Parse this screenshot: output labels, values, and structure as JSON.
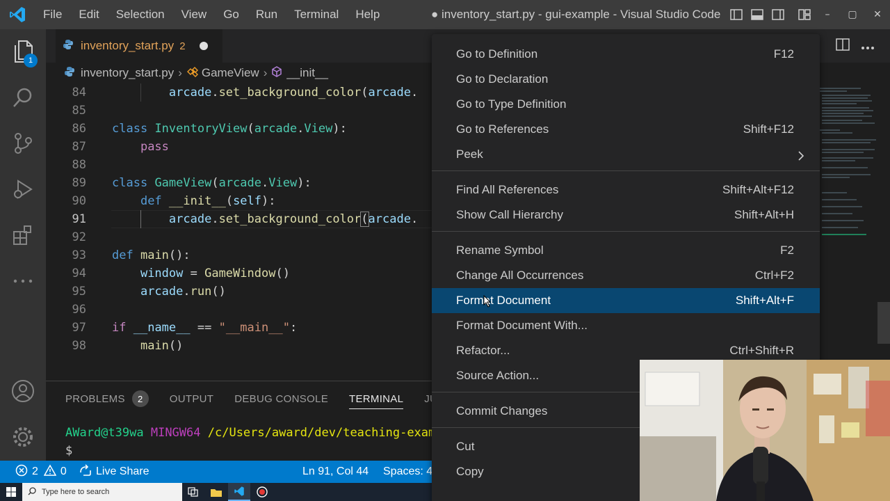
{
  "window": {
    "title": "● inventory_start.py - gui-example - Visual Studio Code"
  },
  "menu": [
    "File",
    "Edit",
    "Selection",
    "View",
    "Go",
    "Run",
    "Terminal",
    "Help"
  ],
  "activity_bar": {
    "explorer_badge": "1"
  },
  "tab": {
    "name": "inventory_start.py",
    "problems": "2"
  },
  "breadcrumb": {
    "file": "inventory_start.py",
    "class": "GameView",
    "method": "__init__"
  },
  "code_lines": [
    {
      "n": "84",
      "text": "        arcade.set_background_color(arcade."
    },
    {
      "n": "85",
      "text": ""
    },
    {
      "n": "86",
      "text": "class InventoryView(arcade.View):"
    },
    {
      "n": "87",
      "text": "    pass"
    },
    {
      "n": "88",
      "text": ""
    },
    {
      "n": "89",
      "text": "class GameView(arcade.View):"
    },
    {
      "n": "90",
      "text": "    def __init__(self):"
    },
    {
      "n": "91",
      "text": "        arcade.set_background_color(arcade."
    },
    {
      "n": "92",
      "text": ""
    },
    {
      "n": "93",
      "text": "def main():"
    },
    {
      "n": "94",
      "text": "    window = GameWindow()"
    },
    {
      "n": "95",
      "text": "    arcade.run()"
    },
    {
      "n": "96",
      "text": ""
    },
    {
      "n": "97",
      "text": "if __name__ == \"__main__\":"
    },
    {
      "n": "98",
      "text": "    main()"
    }
  ],
  "panel": {
    "tabs": [
      "PROBLEMS",
      "OUTPUT",
      "DEBUG CONSOLE",
      "TERMINAL",
      "JUPYT"
    ],
    "problems_count": "2",
    "active_tab": "TERMINAL",
    "terminal": {
      "user": "AWard@t39wa",
      "host": "MINGW64",
      "path": "/c/Users/award/dev/teaching-examp",
      "prompt": "$"
    }
  },
  "statusbar": {
    "errors": "2",
    "warnings": "0",
    "live_share": "Live Share",
    "position": "Ln 91, Col 44",
    "spaces": "Spaces: 4"
  },
  "taskbar": {
    "search_placeholder": "Type here to search"
  },
  "context_menu": {
    "groups": [
      [
        {
          "label": "Go to Definition",
          "shortcut": "F12"
        },
        {
          "label": "Go to Declaration",
          "shortcut": ""
        },
        {
          "label": "Go to Type Definition",
          "shortcut": ""
        },
        {
          "label": "Go to References",
          "shortcut": "Shift+F12"
        },
        {
          "label": "Peek",
          "shortcut": ""
        }
      ],
      [
        {
          "label": "Find All References",
          "shortcut": "Shift+Alt+F12"
        },
        {
          "label": "Show Call Hierarchy",
          "shortcut": "Shift+Alt+H"
        }
      ],
      [
        {
          "label": "Rename Symbol",
          "shortcut": "F2"
        },
        {
          "label": "Change All Occurrences",
          "shortcut": "Ctrl+F2"
        },
        {
          "label": "Format Document",
          "shortcut": "Shift+Alt+F"
        },
        {
          "label": "Format Document With...",
          "shortcut": ""
        },
        {
          "label": "Refactor...",
          "shortcut": "Ctrl+Shift+R"
        },
        {
          "label": "Source Action...",
          "shortcut": ""
        }
      ],
      [
        {
          "label": "Commit Changes",
          "shortcut": ""
        }
      ],
      [
        {
          "label": "Cut",
          "shortcut": ""
        },
        {
          "label": "Copy",
          "shortcut": ""
        }
      ]
    ],
    "highlighted": "Format Document"
  },
  "colors": {
    "accent": "#007acc",
    "selection": "#094771",
    "titlebar": "#3c3c3c"
  }
}
